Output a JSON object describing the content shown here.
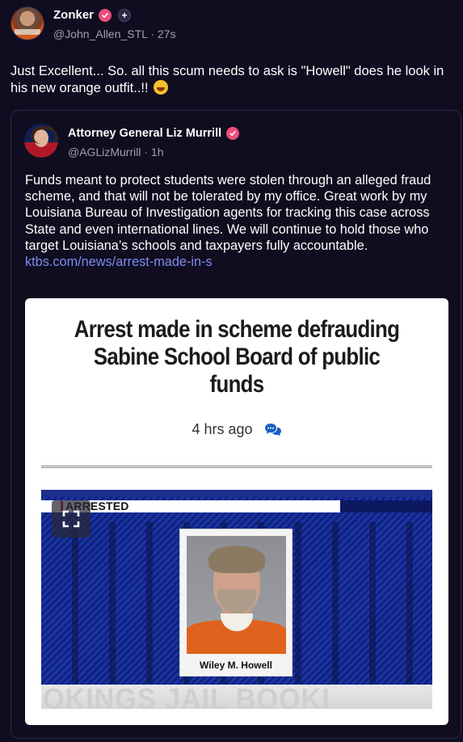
{
  "post": {
    "author_name": "Zonker",
    "handle": "@John_Allen_STL",
    "time": "27s",
    "text": "Just Excellent... So. all this scum needs to ask is \"Howell\" does he look in his new orange outfit..!!"
  },
  "quoted_post": {
    "author_name": "Attorney General Liz Murrill",
    "handle": "@AGLizMurrill",
    "time": "1h",
    "text": "Funds meant to protect students were stolen through an alleged fraud scheme, and that will not be tolerated by my office. Great work by my Louisiana Bureau of Investigation agents for tracking this case across State and even international lines. We will continue to hold those who target Louisiana’s schools and taxpayers fully accountable.",
    "link": "ktbs.com/news/arrest-made-in-s"
  },
  "link_card": {
    "headline": "Arrest made in scheme defrauding Sabine School Board of public funds",
    "time": "4 hrs ago",
    "image": {
      "banner_label": "ARRESTED",
      "caption_name": "Wiley M. Howell",
      "footer_text": "OKINGS   JAIL BOOKI"
    }
  },
  "separator": "·",
  "colors": {
    "background": "#0f0d1f",
    "verified_badge": "#ec4d7c",
    "link": "#7f8bf0",
    "muted_text": "#a19fb3",
    "shirt_orange": "#e0621c"
  },
  "icons": [
    "verified-icon",
    "plus-badge-icon",
    "emoji-rofl-icon",
    "comment-icon",
    "expand-icon"
  ]
}
